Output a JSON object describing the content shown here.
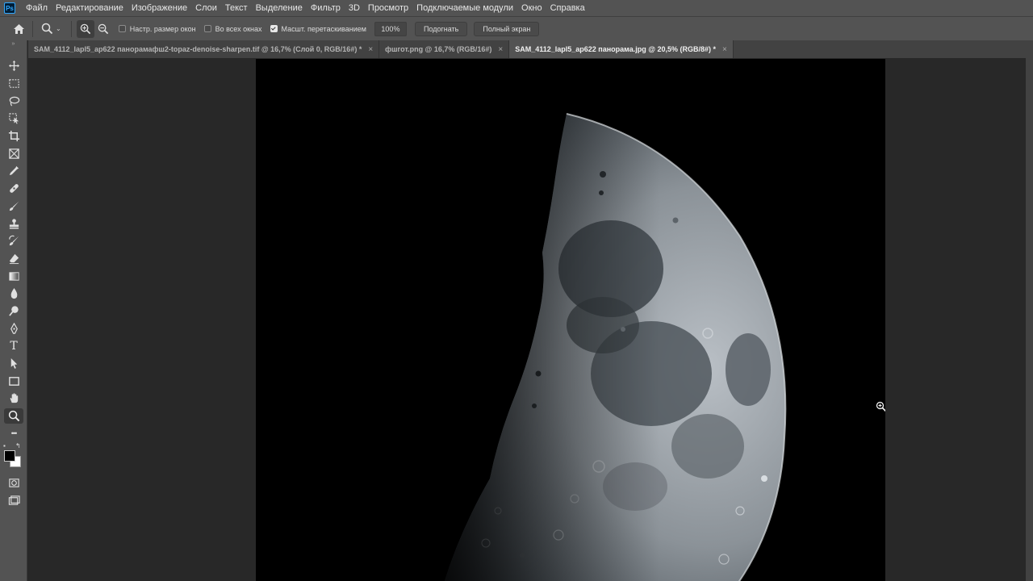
{
  "app": {
    "logo": "Ps"
  },
  "menu": [
    "Файл",
    "Редактирование",
    "Изображение",
    "Слои",
    "Текст",
    "Выделение",
    "Фильтр",
    "3D",
    "Просмотр",
    "Подключаемые модули",
    "Окно",
    "Справка"
  ],
  "options": {
    "home_icon": "home-icon",
    "zoom_tool_icon": "zoom-icon",
    "zoom_in_icon": "zoom-in-icon",
    "zoom_out_icon": "zoom-out-icon",
    "resize_windows": {
      "label": "Настр. размер окон",
      "checked": false
    },
    "all_windows": {
      "label": "Во всех окнах",
      "checked": false
    },
    "scrubby_zoom": {
      "label": "Масшт. перетаскиванием",
      "checked": true
    },
    "zoom_value": "100%",
    "fit_label": "Подогнать",
    "fullscreen_label": "Полный экран"
  },
  "tabs": [
    {
      "label": "SAM_4112_lapl5_ap622 панорамафш2-topaz-denoise-sharpen.tif @ 16,7% (Слой 0, RGB/16#) *",
      "close": "×",
      "active": false
    },
    {
      "label": "фшгот.png @ 16,7% (RGB/16#)",
      "close": "×",
      "active": false
    },
    {
      "label": "SAM_4112_lapl5_ap622 панорама.jpg @ 20,5% (RGB/8#) *",
      "close": "×",
      "active": true
    }
  ],
  "tools": [
    "move-icon",
    "marquee-icon",
    "lasso-icon",
    "object-select-icon",
    "crop-icon",
    "frame-icon",
    "eyedropper-icon",
    "healing-icon",
    "brush-icon",
    "stamp-icon",
    "history-brush-icon",
    "eraser-icon",
    "gradient-icon",
    "blur-icon",
    "dodge-icon",
    "pen-icon",
    "type-icon",
    "path-select-icon",
    "rectangle-icon",
    "hand-icon",
    "zoom-icon",
    "more-icon"
  ],
  "active_tool": "zoom-icon",
  "type_tool_glyph": "T",
  "more_glyph": "•••",
  "colors": {
    "foreground": "#000000",
    "background": "#ffffff",
    "ui_bar": "#535353",
    "workspace": "#282828"
  }
}
